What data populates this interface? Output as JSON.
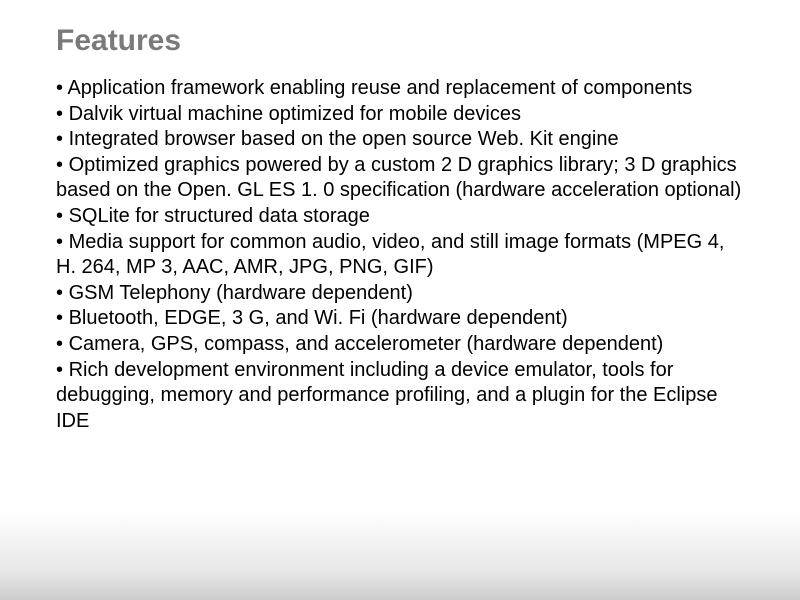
{
  "title": "Features",
  "bullets": [
    "Application framework enabling reuse and replacement of components",
    "Dalvik virtual machine optimized for mobile devices",
    "Integrated browser based on the open source Web. Kit engine",
    "Optimized graphics powered by a custom 2 D graphics library; 3 D graphics based on the Open. GL ES 1. 0 specification (hardware acceleration optional)",
    "SQLite for structured data storage",
    "Media support for common audio, video, and still image formats (MPEG 4, H. 264, MP 3, AAC, AMR, JPG, PNG, GIF)",
    "GSM Telephony (hardware dependent)",
    "Bluetooth, EDGE, 3 G, and Wi. Fi (hardware dependent)",
    "Camera, GPS, compass, and accelerometer (hardware dependent)",
    "Rich development environment including a device emulator, tools for debugging, memory and performance profiling, and a plugin for the Eclipse IDE"
  ]
}
